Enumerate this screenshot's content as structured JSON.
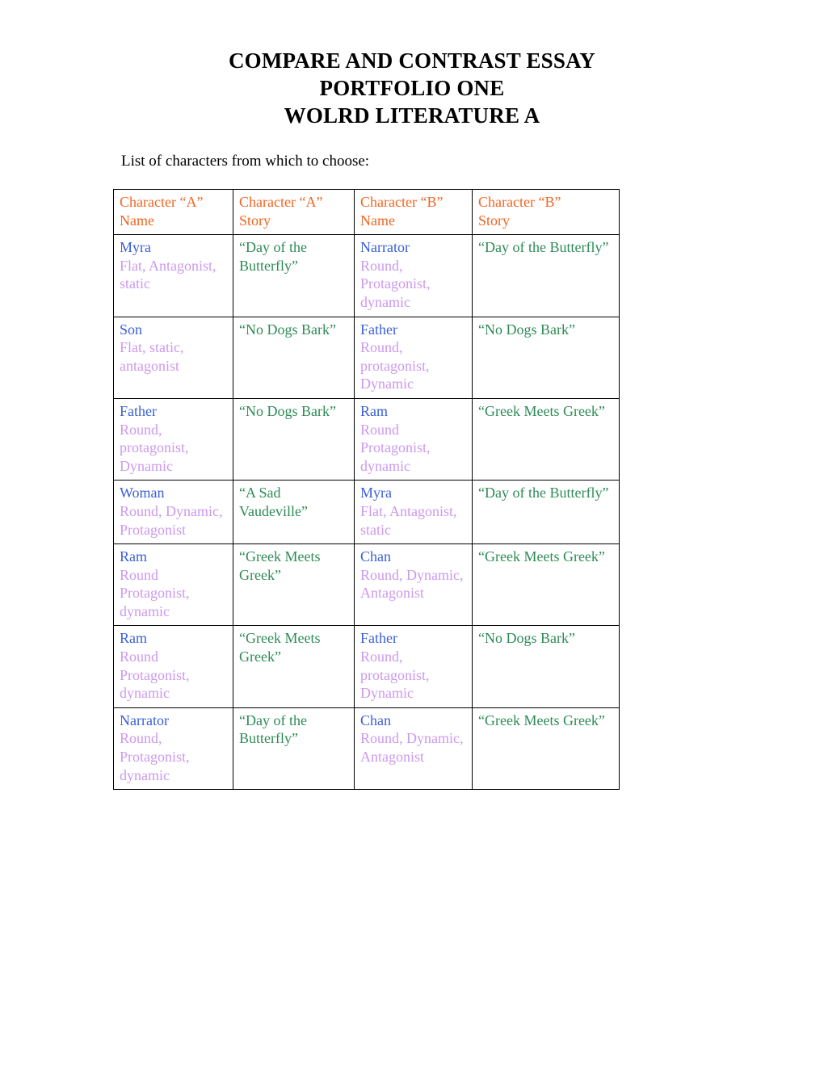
{
  "document": {
    "title_lines": [
      "COMPARE AND CONTRAST ESSAY",
      "PORTFOLIO ONE",
      "WOLRD LITERATURE A"
    ],
    "intro_text": "List of characters from which to choose:"
  },
  "colors": {
    "header_orange": "#F26522",
    "name_blue": "#3B5FD8",
    "trait_lavender": "#CC99EE",
    "story_green": "#2E8B57",
    "border_black": "#000000",
    "body_black": "#000000"
  },
  "table": {
    "headers": [
      "Character “A” Name",
      "Character “A” Story",
      "Character “B” Name",
      "Character “B” Story"
    ],
    "headers_wrapped": [
      [
        "Character “A”",
        "Name"
      ],
      [
        "Character “A”",
        "Story"
      ],
      [
        "Character “B”",
        "Name"
      ],
      [
        "Character “B”",
        "Story"
      ]
    ],
    "rows": [
      {
        "a_name": "Myra",
        "a_traits": "Flat, Antagonist, static",
        "a_story": "“Day of the Butterfly”",
        "b_name": "Narrator",
        "b_traits": "Round, Protagonist, dynamic",
        "b_story": "“Day of the Butterfly”"
      },
      {
        "a_name": "Son",
        "a_traits": "Flat, static, antagonist",
        "a_story": "“No Dogs Bark”",
        "b_name": "Father",
        "b_traits": "Round, protagonist, Dynamic",
        "b_story": "“No Dogs Bark”"
      },
      {
        "a_name": "Father",
        "a_traits": "Round, protagonist, Dynamic",
        "a_story": "“No Dogs Bark”",
        "b_name": "Ram",
        "b_traits": "Round Protagonist, dynamic",
        "b_story": "“Greek Meets Greek”"
      },
      {
        "a_name": "Woman",
        "a_traits": "Round, Dynamic, Protagonist",
        "a_story": "“A Sad Vaudeville”",
        "b_name": "Myra",
        "b_traits": "Flat, Antagonist, static",
        "b_story": "“Day of the Butterfly”"
      },
      {
        "a_name": "Ram",
        "a_traits": "Round Protagonist, dynamic",
        "a_story": "“Greek Meets Greek”",
        "b_name": "Chan",
        "b_traits": "Round, Dynamic, Antagonist",
        "b_story": "“Greek Meets Greek”"
      },
      {
        "a_name": "Ram",
        "a_traits": "Round Protagonist, dynamic",
        "a_story": "“Greek Meets Greek”",
        "b_name": "Father",
        "b_traits": "Round, protagonist, Dynamic",
        "b_story": "“No Dogs Bark”"
      },
      {
        "a_name": "Narrator",
        "a_traits": "Round, Protagonist, dynamic",
        "a_story": "“Day of the Butterfly”",
        "b_name": "Chan",
        "b_traits": "Round, Dynamic, Antagonist",
        "b_story": "“Greek Meets Greek”"
      }
    ]
  }
}
